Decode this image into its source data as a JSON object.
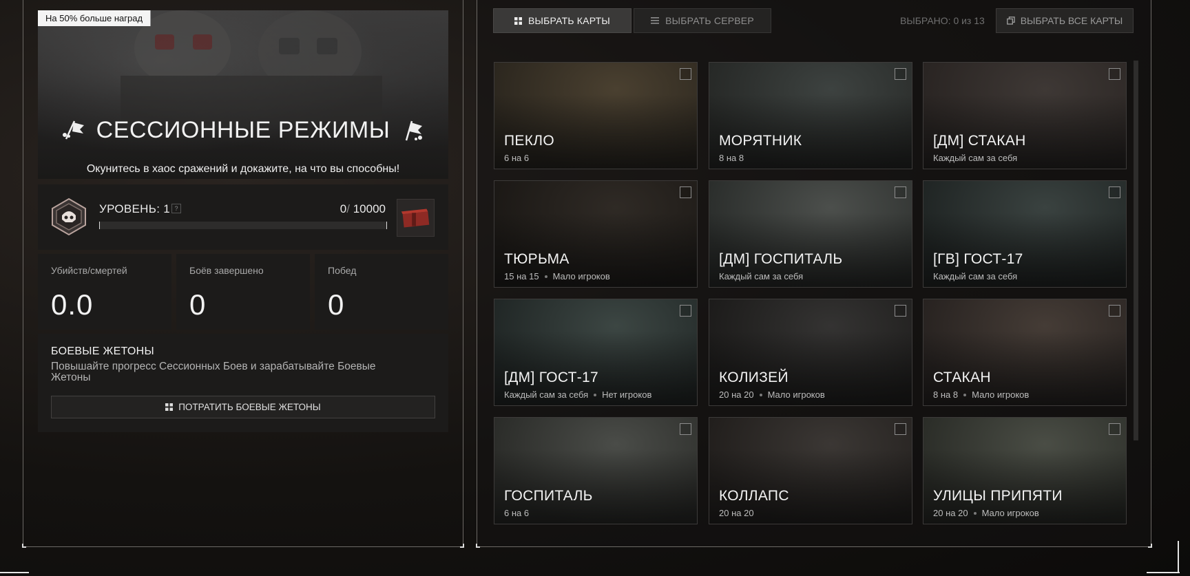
{
  "hero": {
    "badge": "На 50% больше наград",
    "title": "СЕССИОННЫЕ РЕЖИМЫ",
    "subtitle": "Окунитесь в хаос сражений и докажите, на что вы способны!"
  },
  "level": {
    "label": "УРОВЕНЬ: 1",
    "help": "?",
    "xp_current": "0",
    "xp_separator": "/",
    "xp_max": "10000",
    "progress_fraction": 0.0
  },
  "stats": [
    {
      "label": "Убийств/смертей",
      "value": "0.0"
    },
    {
      "label": "Боёв завершено",
      "value": "0"
    },
    {
      "label": "Побед",
      "value": "0"
    }
  ],
  "tokens": {
    "title": "БОЕВЫЕ ЖЕТОНЫ",
    "description": "Повышайте прогресс Сессионных Боев и зарабатывайте Боевые Жетоны",
    "button_label": "ПОТРАТИТЬ БОЕВЫЕ ЖЕТОНЫ"
  },
  "toolbar": {
    "tab_maps": "ВЫБРАТЬ КАРТЫ",
    "tab_server": "ВЫБРАТЬ СЕРВЕР",
    "selected_count": "ВЫБРАНО: 0 из 13",
    "select_all": "ВЫБРАТЬ ВСЕ КАРТЫ"
  },
  "maps": [
    {
      "name": "ПЕКЛО",
      "mode": "6 на 6",
      "note": ""
    },
    {
      "name": "МОРЯТНИК",
      "mode": "8 на 8",
      "note": ""
    },
    {
      "name": "[ДМ] СТАКАН",
      "mode": "Каждый сам за себя",
      "note": ""
    },
    {
      "name": "ТЮРЬМА",
      "mode": "15 на 15",
      "note": "Мало игроков"
    },
    {
      "name": "[ДМ] ГОСПИТАЛЬ",
      "mode": "Каждый сам за себя",
      "note": ""
    },
    {
      "name": "[ГВ] ГОСТ-17",
      "mode": "Каждый сам за себя",
      "note": ""
    },
    {
      "name": "[ДМ] ГОСТ-17",
      "mode": "Каждый сам за себя",
      "note": "Нет игроков"
    },
    {
      "name": "КОЛИЗЕЙ",
      "mode": "20 на 20",
      "note": "Мало игроков"
    },
    {
      "name": "СТАКАН",
      "mode": "8 на 8",
      "note": "Мало игроков"
    },
    {
      "name": "ГОСПИТАЛЬ",
      "mode": "6 на 6",
      "note": ""
    },
    {
      "name": "КОЛЛАПС",
      "mode": "20 на 20",
      "note": ""
    },
    {
      "name": "УЛИЦЫ ПРИПЯТИ",
      "mode": "20 на 20",
      "note": "Мало игроков"
    }
  ],
  "icons": {
    "tab_maps": "grid-icon",
    "tab_server": "list-icon",
    "select_all": "copy-icon",
    "tokens_button": "grid-icon",
    "level": "skull-emblem-icon",
    "reward": "red-crate-icon",
    "title_flags": "flag-icon"
  }
}
